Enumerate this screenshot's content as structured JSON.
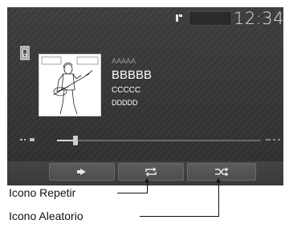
{
  "screen": {
    "clock": "12:34",
    "track": {
      "line_a": "AAAAA",
      "title": "BBBBB",
      "line_c": "CCCCC",
      "line_d": "DDDDD"
    },
    "progress": {
      "elapsed_fraction": 0.09
    },
    "controls": [
      {
        "name": "play-button",
        "icon": "play-icon"
      },
      {
        "name": "repeat-button",
        "icon": "repeat-icon"
      },
      {
        "name": "shuffle-button",
        "icon": "shuffle-icon"
      }
    ]
  },
  "callouts": {
    "repeat": "Icono Repetir",
    "shuffle": "Icono Aleatorio"
  }
}
